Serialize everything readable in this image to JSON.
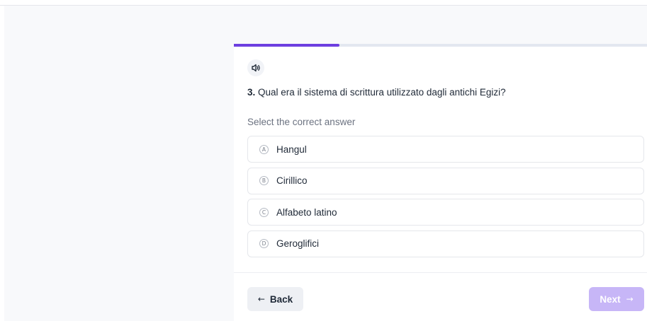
{
  "quiz": {
    "progress_fraction": 0.255,
    "accent_color": "#6d3fe0",
    "audio_icon": "speaker-icon",
    "question_number": "3.",
    "question_text": "Qual era il sistema di scrittura utilizzato dagli antichi Egizi?",
    "hint": "Select the correct answer",
    "options": [
      {
        "letter": "A",
        "label": "Hangul"
      },
      {
        "letter": "B",
        "label": "Cirillico"
      },
      {
        "letter": "C",
        "label": "Alfabeto latino"
      },
      {
        "letter": "D",
        "label": "Geroglifici"
      }
    ]
  },
  "navigation": {
    "back_arrow": "←",
    "back_label": "Back",
    "next_label": "Next",
    "next_arrow": "→"
  }
}
